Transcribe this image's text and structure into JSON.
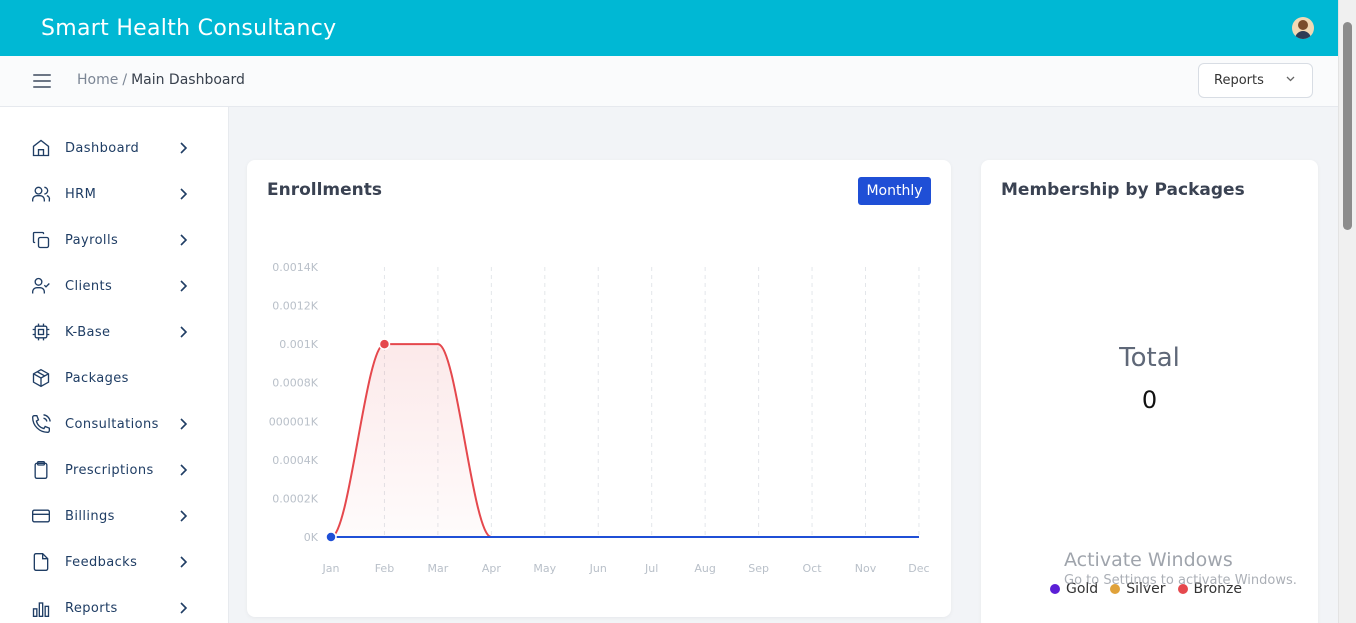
{
  "app": {
    "title": "Smart Health Consultancy"
  },
  "breadcrumb": {
    "home": "Home",
    "separator": "/",
    "current": "Main Dashboard"
  },
  "reports_dropdown": {
    "label": "Reports",
    "icon": "chevron-down-icon"
  },
  "sidebar": {
    "items": [
      {
        "label": "Dashboard",
        "icon": "home-icon",
        "has_chevron": true
      },
      {
        "label": "HRM",
        "icon": "users-icon",
        "has_chevron": true
      },
      {
        "label": "Payrolls",
        "icon": "copy-icon",
        "has_chevron": true
      },
      {
        "label": "Clients",
        "icon": "user-check-icon",
        "has_chevron": true
      },
      {
        "label": "K-Base",
        "icon": "cpu-icon",
        "has_chevron": true
      },
      {
        "label": "Packages",
        "icon": "package-icon",
        "has_chevron": false
      },
      {
        "label": "Consultations",
        "icon": "phone-call-icon",
        "has_chevron": true
      },
      {
        "label": "Prescriptions",
        "icon": "clipboard-icon",
        "has_chevron": true
      },
      {
        "label": "Billings",
        "icon": "credit-card-icon",
        "has_chevron": true
      },
      {
        "label": "Feedbacks",
        "icon": "file-icon",
        "has_chevron": true
      },
      {
        "label": "Reports",
        "icon": "bar-chart-icon",
        "has_chevron": true
      }
    ]
  },
  "enrollments": {
    "title": "Enrollments",
    "period_button": "Monthly"
  },
  "chart_data": {
    "type": "area",
    "title": "Enrollments",
    "categories": [
      "Jan",
      "Feb",
      "Mar",
      "Apr",
      "May",
      "Jun",
      "Jul",
      "Aug",
      "Sep",
      "Oct",
      "Nov",
      "Dec"
    ],
    "y_tick_labels": [
      "0K",
      "0.0002K",
      "0.0004K",
      "000001K",
      "0.0008K",
      "0.001K",
      "0.0012K",
      "0.0014K"
    ],
    "ylim": [
      0,
      0.0014
    ],
    "grid": "vertical dashed",
    "series": [
      {
        "values": [
          0,
          0.001,
          0.001,
          0,
          0,
          0,
          0,
          0,
          0,
          0,
          0,
          0
        ],
        "color": "#e5484d"
      },
      {
        "values": [
          0,
          0,
          0,
          0,
          0,
          0,
          0,
          0,
          0,
          0,
          0,
          0
        ],
        "color": "#1f4fd6"
      }
    ]
  },
  "membership": {
    "title": "Membership by Packages",
    "total_label": "Total",
    "total_value": "0",
    "legend": [
      {
        "label": "Gold",
        "color": "#5b1fd6"
      },
      {
        "label": "Silver",
        "color": "#e0a23a"
      },
      {
        "label": "Bronze",
        "color": "#e5484d"
      }
    ]
  },
  "watermark": {
    "title": "Activate Windows",
    "subtitle": "Go to Settings to activate Windows."
  },
  "colors": {
    "topbar": "#00b8d4",
    "accent": "#1f4fd6",
    "nav_text": "#1f3d64"
  }
}
